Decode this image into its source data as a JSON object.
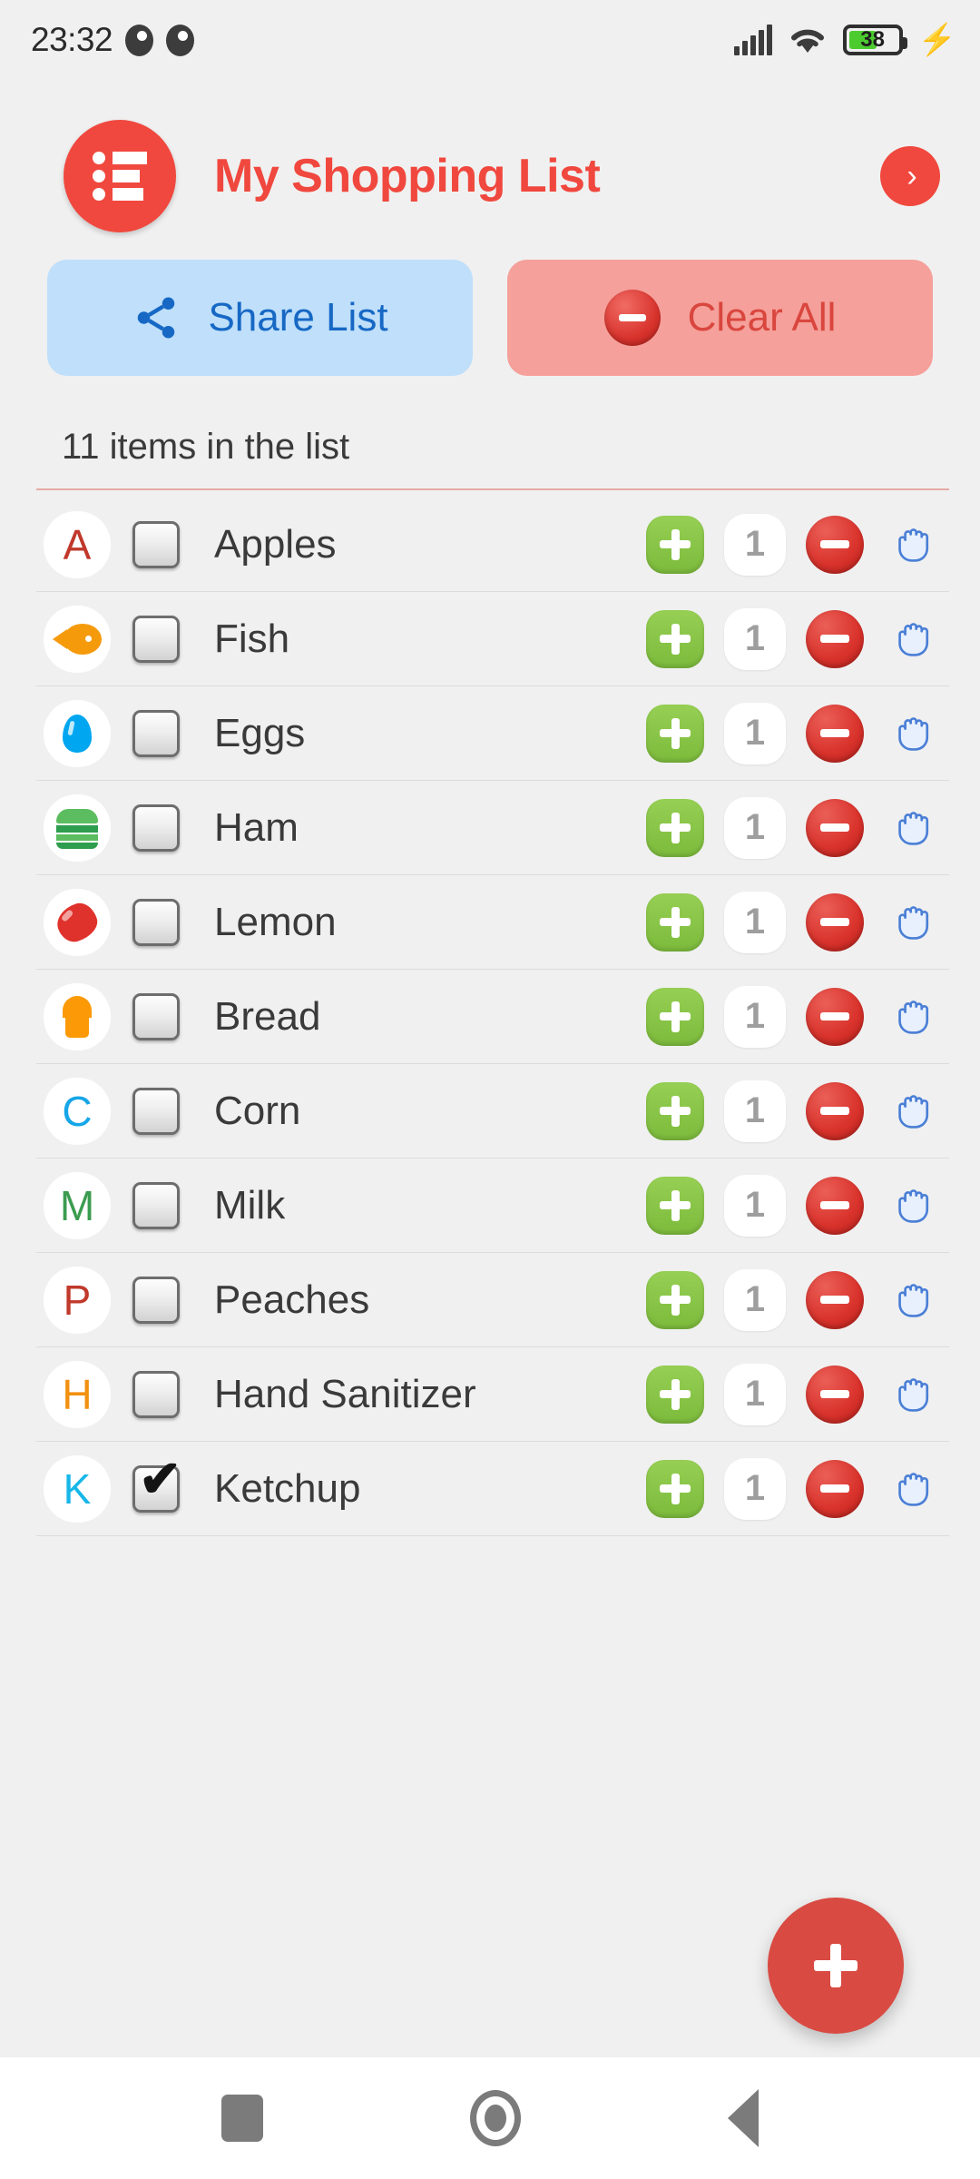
{
  "status_bar": {
    "clock": "23:32",
    "left_icons": [
      "moon-phase-icon",
      "moon-phase-icon"
    ],
    "signal_icon": "cellular-signal-icon",
    "wifi_icon": "wifi-icon",
    "battery_level": "38",
    "battery_icon": "battery-icon",
    "charging_icon": "charging-bolt-icon"
  },
  "header": {
    "logo_icon": "list-logo-icon",
    "title": "My Shopping List",
    "next_icon": "chevron-right-icon"
  },
  "actions": {
    "share": {
      "label": "Share List",
      "icon": "share-icon"
    },
    "clear": {
      "label": "Clear All",
      "icon": "minus-circle-icon"
    }
  },
  "list_meta": {
    "count_text": "11 items in the list"
  },
  "row_controls": {
    "increment_icon": "plus-icon",
    "decrement_icon": "minus-icon",
    "drag_icon": "hand-drag-icon",
    "checkbox_checked_glyph": "✔"
  },
  "items": [
    {
      "name": "Apples",
      "avatar_type": "letter",
      "avatar_text": "A",
      "avatar_color": "#c0392b",
      "checked": false,
      "qty": "1"
    },
    {
      "name": "Fish",
      "avatar_type": "fish",
      "avatar_text": "",
      "avatar_color": "#f59a0b",
      "checked": false,
      "qty": "1"
    },
    {
      "name": "Eggs",
      "avatar_type": "drop",
      "avatar_text": "",
      "avatar_color": "#00a6f0",
      "checked": false,
      "qty": "1"
    },
    {
      "name": "Ham",
      "avatar_type": "burger",
      "avatar_text": "",
      "avatar_color": "#4caf50",
      "checked": false,
      "qty": "1"
    },
    {
      "name": "Lemon",
      "avatar_type": "lemon",
      "avatar_text": "",
      "avatar_color": "#e0322c",
      "checked": false,
      "qty": "1"
    },
    {
      "name": "Bread",
      "avatar_type": "bread",
      "avatar_text": "",
      "avatar_color": "#fb9a06",
      "checked": false,
      "qty": "1"
    },
    {
      "name": "Corn",
      "avatar_type": "letter",
      "avatar_text": "C",
      "avatar_color": "#16a6e8",
      "checked": false,
      "qty": "1"
    },
    {
      "name": "Milk",
      "avatar_type": "letter",
      "avatar_text": "M",
      "avatar_color": "#3b9c4f",
      "checked": false,
      "qty": "1"
    },
    {
      "name": "Peaches",
      "avatar_type": "letter",
      "avatar_text": "P",
      "avatar_color": "#c0392b",
      "checked": false,
      "qty": "1"
    },
    {
      "name": "Hand Sanitizer",
      "avatar_type": "letter",
      "avatar_text": "H",
      "avatar_color": "#f29010",
      "checked": false,
      "qty": "1"
    },
    {
      "name": "Ketchup",
      "avatar_type": "letter",
      "avatar_text": "K",
      "avatar_color": "#16b7e8",
      "checked": true,
      "qty": "1"
    }
  ],
  "fab": {
    "icon": "plus-icon"
  },
  "navbar": {
    "recents_icon": "recents-square-icon",
    "home_icon": "home-circle-icon",
    "back_icon": "back-triangle-icon"
  },
  "colors": {
    "brand_red": "#f0483e",
    "share_bg": "#bfdffa",
    "share_fg": "#1668c4",
    "clear_bg": "#f5a09a",
    "clear_fg": "#d9463e",
    "plus_green": "#7cbb3c",
    "minus_red": "#d9332c",
    "page_bg": "#f0f0f0"
  }
}
